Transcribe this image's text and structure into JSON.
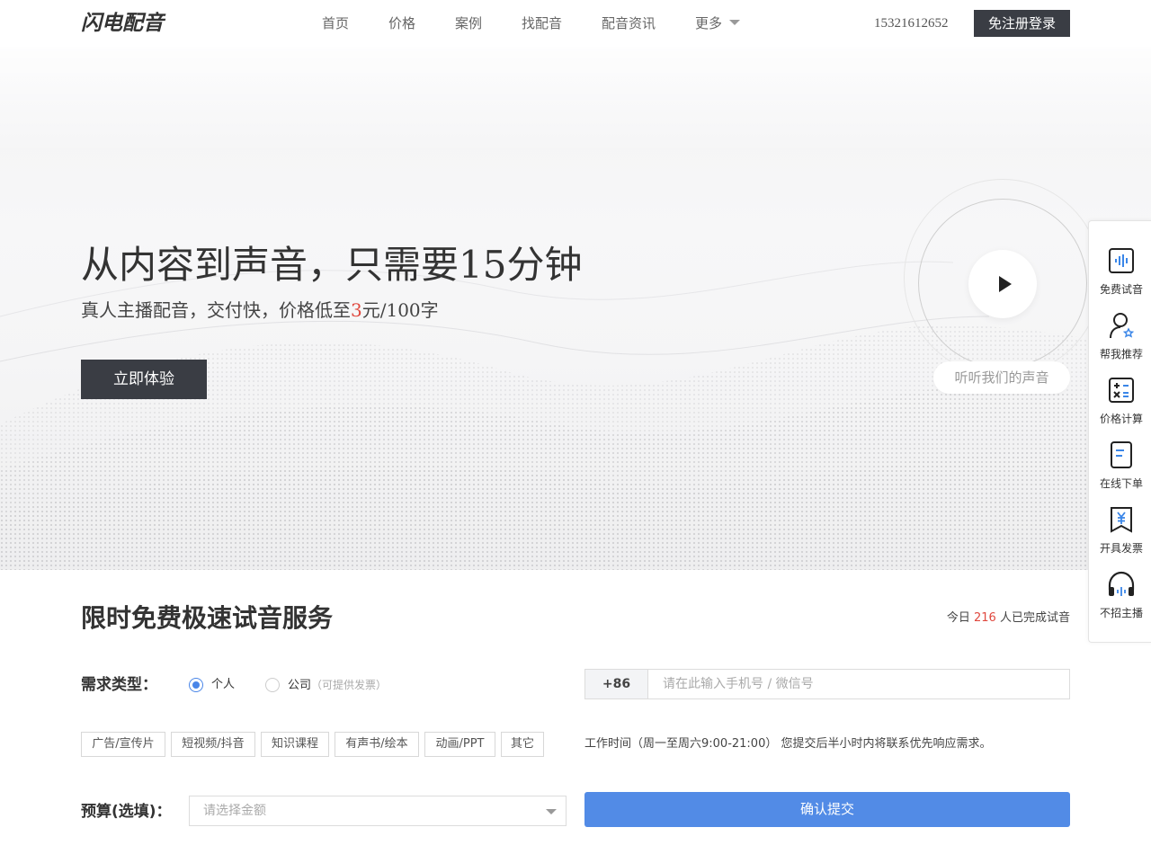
{
  "header": {
    "logo": "闪电配音",
    "nav": [
      {
        "label": "首页"
      },
      {
        "label": "价格"
      },
      {
        "label": "案例"
      },
      {
        "label": "找配音"
      },
      {
        "label": "配音资讯"
      },
      {
        "label": "更多"
      }
    ],
    "phone": "15321612652",
    "login_label": "免注册登录"
  },
  "hero": {
    "title": "从内容到声音，只需要15分钟",
    "subtitle_prefix": "真人主播配音，交付快，价格低至",
    "subtitle_price": "3",
    "subtitle_suffix": "元/100字",
    "cta_label": "立即体验",
    "listen_label": "听听我们的声音"
  },
  "sidebar": {
    "items": [
      {
        "label": "免费试音",
        "icon": "voice-wave-icon"
      },
      {
        "label": "帮我推荐",
        "icon": "user-star-icon"
      },
      {
        "label": "价格计算",
        "icon": "calculator-icon"
      },
      {
        "label": "在线下单",
        "icon": "order-form-icon"
      },
      {
        "label": "开具发票",
        "icon": "invoice-icon"
      },
      {
        "label": "不招主播",
        "icon": "headphones-icon"
      }
    ]
  },
  "form": {
    "title": "限时免费极速试音服务",
    "today_prefix": "今日",
    "today_count": "216",
    "today_suffix": "人已完成试音",
    "type_label": "需求类型：",
    "radio_personal": "个人",
    "radio_company": "公司",
    "radio_company_hint": "（可提供发票）",
    "tags": [
      "广告/宣传片",
      "短视频/抖音",
      "知识课程",
      "有声书/绘本",
      "动画/PPT",
      "其它"
    ],
    "budget_label": "预算(选填)：",
    "budget_placeholder": "请选择金额",
    "phone_prefix": "+86",
    "phone_placeholder": "请在此输入手机号 / 微信号",
    "work_time": "工作时间（周一至周六9:00-21:00） 您提交后半小时内将联系优先响应需求。",
    "submit_label": "确认提交"
  },
  "colors": {
    "accent_red": "#e0483e",
    "primary_blue": "#528be6",
    "dark_button": "#3a3d44"
  }
}
